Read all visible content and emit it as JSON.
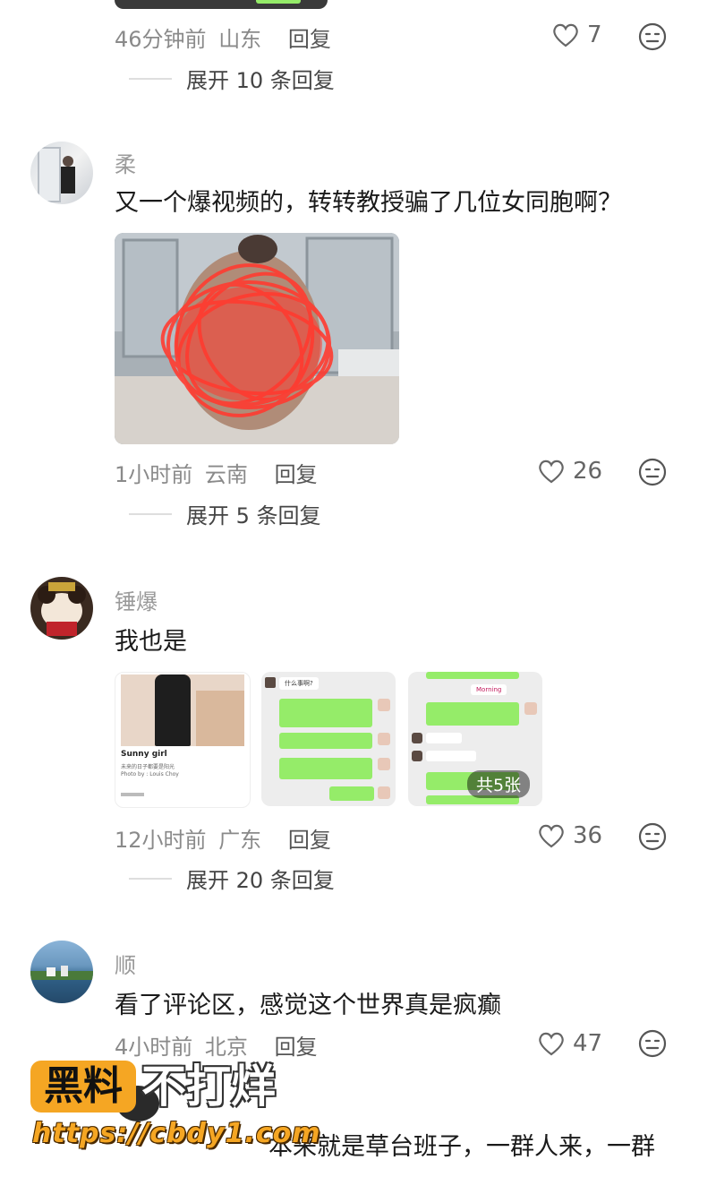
{
  "comments": [
    {
      "time": "46分钟前",
      "location": "山东",
      "reply_label": "回复",
      "likes": "7",
      "expand_label": "展开 10 条回复"
    },
    {
      "username": "柔",
      "text": "又一个爆视频的，转转教授骗了几位女同胞啊？",
      "time": "1小时前",
      "location": "云南",
      "reply_label": "回复",
      "likes": "26",
      "expand_label": "展开 5 条回复"
    },
    {
      "username": "锤爆",
      "text": "我也是",
      "time": "12小时前",
      "location": "广东",
      "reply_label": "回复",
      "likes": "36",
      "expand_label": "展开 20 条回复",
      "image_badge": "共5张",
      "images": [
        {
          "caption": "Sunny girl",
          "subcaption": "未来的日子都要是阳光",
          "credit": "Photo by : Louis Choy"
        },
        {
          "chat_header": "什么事啊?"
        },
        {
          "chat_header": "Morning"
        }
      ]
    },
    {
      "username": "顺",
      "text": "看了评论区，感觉这个世界真是疯癫",
      "time": "4小时前",
      "location": "北京",
      "reply_label": "回复",
      "likes": "47"
    },
    {
      "text_partial": "本来就是草台班子，一群人来，一群"
    }
  ],
  "watermark": {
    "brand_box": "黑料",
    "brand_rest": "不打烊",
    "url": "https://cbdy1.com"
  },
  "colors": {
    "watermark_orange": "#f5a623",
    "chat_green": "#95ec69"
  }
}
